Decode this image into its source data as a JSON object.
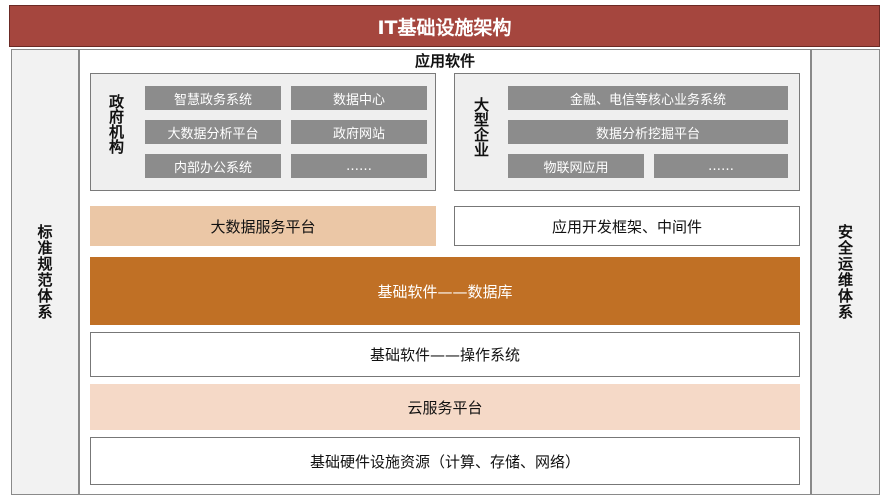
{
  "title": "IT基础设施架构",
  "left_side": "标准规范体系",
  "right_side": "安全运维体系",
  "application_software": {
    "title": "应用软件",
    "government": {
      "label": "政府机构",
      "items": [
        "智慧政务系统",
        "数据中心",
        "大数据分析平台",
        "政府网站",
        "内部办公系统",
        "……"
      ]
    },
    "enterprise": {
      "label": "大型企业",
      "items": [
        "金融、电信等核心业务系统",
        "数据分析挖掘平台",
        "物联网应用",
        "……"
      ]
    }
  },
  "layers": {
    "big_data_platform": "大数据服务平台",
    "app_framework": "应用开发框架、中间件",
    "database": "基础软件——数据库",
    "os": "基础软件——操作系统",
    "cloud": "云服务平台",
    "hardware": "基础硬件设施资源（计算、存储、网络）"
  },
  "colors": {
    "title_bar": "#a5463e",
    "database_layer": "#c07025",
    "peach_layer": "#ebc7a6",
    "cloud_layer": "#f5d9c7",
    "chip": "#8c8c8c"
  }
}
